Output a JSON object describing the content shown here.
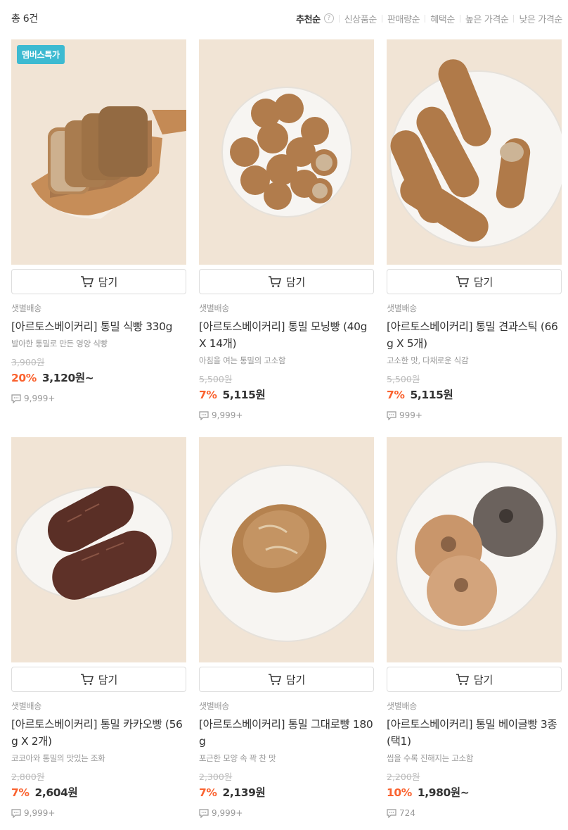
{
  "header": {
    "total": "총 6건",
    "sorts": [
      "추천순",
      "신상품순",
      "판매량순",
      "혜택순",
      "높은 가격순",
      "낮은 가격순"
    ],
    "help_icon": "?"
  },
  "cart_label": "담기",
  "products": [
    {
      "badge": "멤버스특가",
      "delivery": "샛별배송",
      "name": "[아르토스베이커리] 통밀 식빵 330g",
      "desc": "발아한 통밀로 만든 영양 식빵",
      "original_price": "3,900원",
      "discount": "20%",
      "price": "3,120원~",
      "reviews": "9,999+"
    },
    {
      "badge": "",
      "delivery": "샛별배송",
      "name": "[아르토스베이커리] 통밀 모닝빵 (40g X 14개)",
      "desc": "아침을 여는 통밀의 고소함",
      "original_price": "5,500원",
      "discount": "7%",
      "price": "5,115원",
      "reviews": "9,999+"
    },
    {
      "badge": "",
      "delivery": "샛별배송",
      "name": "[아르토스베이커리] 통밀 견과스틱 (66g X 5개)",
      "desc": "고소한 맛, 다채로운 식감",
      "original_price": "5,500원",
      "discount": "7%",
      "price": "5,115원",
      "reviews": "999+"
    },
    {
      "badge": "",
      "delivery": "샛별배송",
      "name": "[아르토스베이커리] 통밀 카카오빵 (56g X 2개)",
      "desc": "코코아와 통밀의 맛있는 조화",
      "original_price": "2,800원",
      "discount": "7%",
      "price": "2,604원",
      "reviews": "9,999+"
    },
    {
      "badge": "",
      "delivery": "샛별배송",
      "name": "[아르토스베이커리] 통밀 그대로빵 180g",
      "desc": "포근한 모양 속 꽉 찬 맛",
      "original_price": "2,300원",
      "discount": "7%",
      "price": "2,139원",
      "reviews": "9,999+"
    },
    {
      "badge": "",
      "delivery": "샛별배송",
      "name": "[아르토스베이커리] 통밀 베이글빵 3종 (택1)",
      "desc": "씹을 수록 진해지는 고소함",
      "original_price": "2,200원",
      "discount": "10%",
      "price": "1,980원~",
      "reviews": "724"
    }
  ],
  "colors": {
    "accent": "#fa622f",
    "badge": "#3dbad1",
    "muted": "#999999"
  }
}
